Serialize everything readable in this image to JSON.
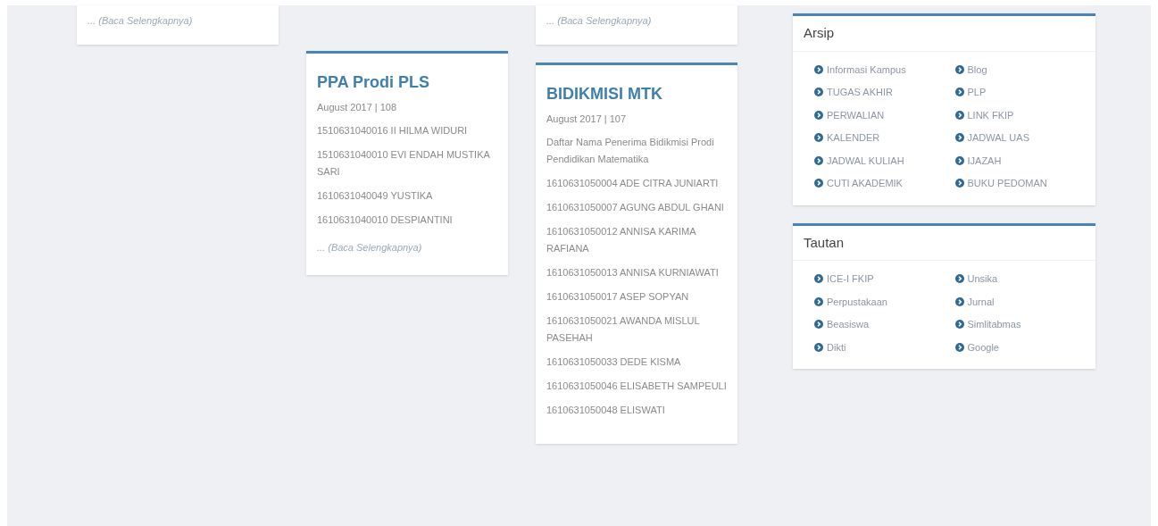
{
  "columns": [
    {
      "cards": [
        {
          "more": "... (Baca Selengkapnya)"
        }
      ]
    },
    {
      "cards": [
        {
          "title": "PPA Prodi PLS",
          "meta": "August 2017 | 108",
          "items": [
            "1510631040016 II HILMA WIDURI",
            "1510631040010 EVI ENDAH MUSTIKA SARI",
            "1610631040049 YUSTIKA",
            "1610631040010 DESPIANTINI"
          ],
          "more": "... (Baca Selengkapnya)"
        }
      ]
    },
    {
      "cards": [
        {
          "more": "... (Baca Selengkapnya)"
        },
        {
          "title": "BIDIKMISI MTK",
          "meta": "August 2017 | 107",
          "items": [
            "Daftar Nama Penerima Bidikmisi Prodi Pendidikan Matematika",
            "1610631050004 ADE CITRA JUNIARTI",
            "1610631050007 AGUNG ABDUL GHANI",
            "1610631050012 ANNISA KARIMA RAFIANA",
            "1610631050013 ANNISA KURNIAWATI",
            "1610631050017 ASEP SOPYAN",
            "1610631050021 AWANDA MISLUL PASEHAH",
            "1610631050033 DEDE KISMA",
            "1610631050046 ELISABETH SAMPEULI",
            "1610631050048 ELISWATI"
          ]
        }
      ]
    }
  ],
  "sidebar": [
    {
      "title": "Arsip",
      "links": [
        "Informasi Kampus",
        "Blog",
        "TUGAS AKHIR",
        "PLP",
        "PERWALIAN",
        "LINK FKIP",
        "KALENDER",
        "JADWAL UAS",
        "JADWAL KULIAH",
        "IJAZAH",
        "CUTI AKADEMIK",
        "BUKU PEDOMAN"
      ]
    },
    {
      "title": "Tautan",
      "links": [
        "ICE-I FKIP",
        "Unsika",
        "Perpustakaan",
        "Jurnal",
        "Beasiswa",
        "Simlitabmas",
        "Dikti",
        "Google"
      ]
    }
  ]
}
